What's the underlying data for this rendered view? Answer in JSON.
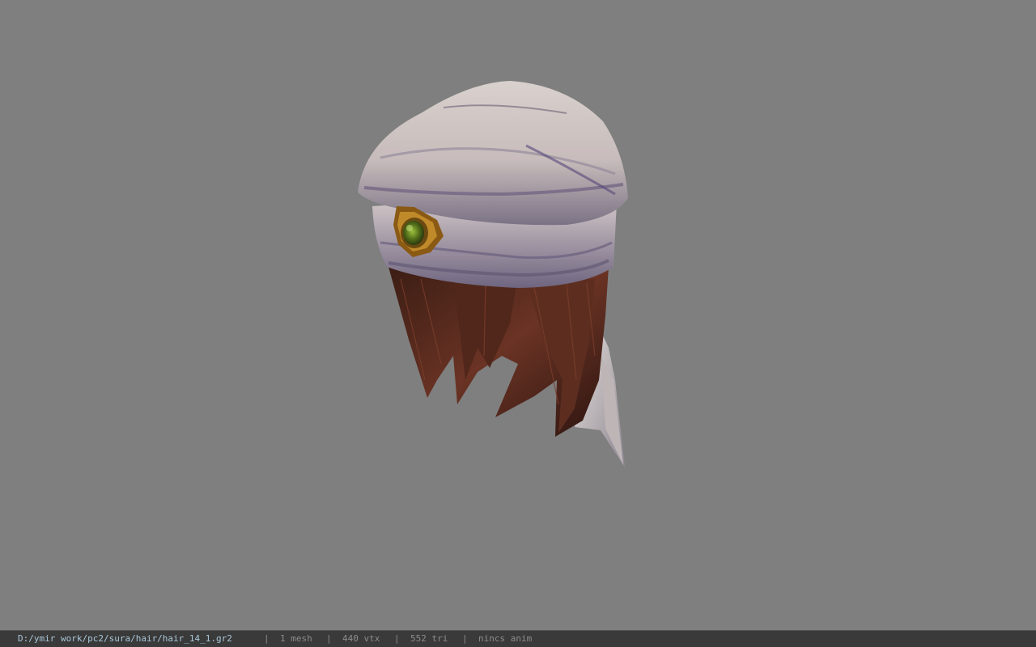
{
  "viewport": {
    "background": "#7f7f7f",
    "model_name": "hair_14_1"
  },
  "status_bar": {
    "file_path": "D:/ymir work/pc2/sura/hair/hair_14_1.gr2",
    "separator": "|",
    "mesh_count": "1 mesh",
    "vertex_count": "440 vtx",
    "triangle_count": "552 tri",
    "anim_status": "nincs anim"
  }
}
